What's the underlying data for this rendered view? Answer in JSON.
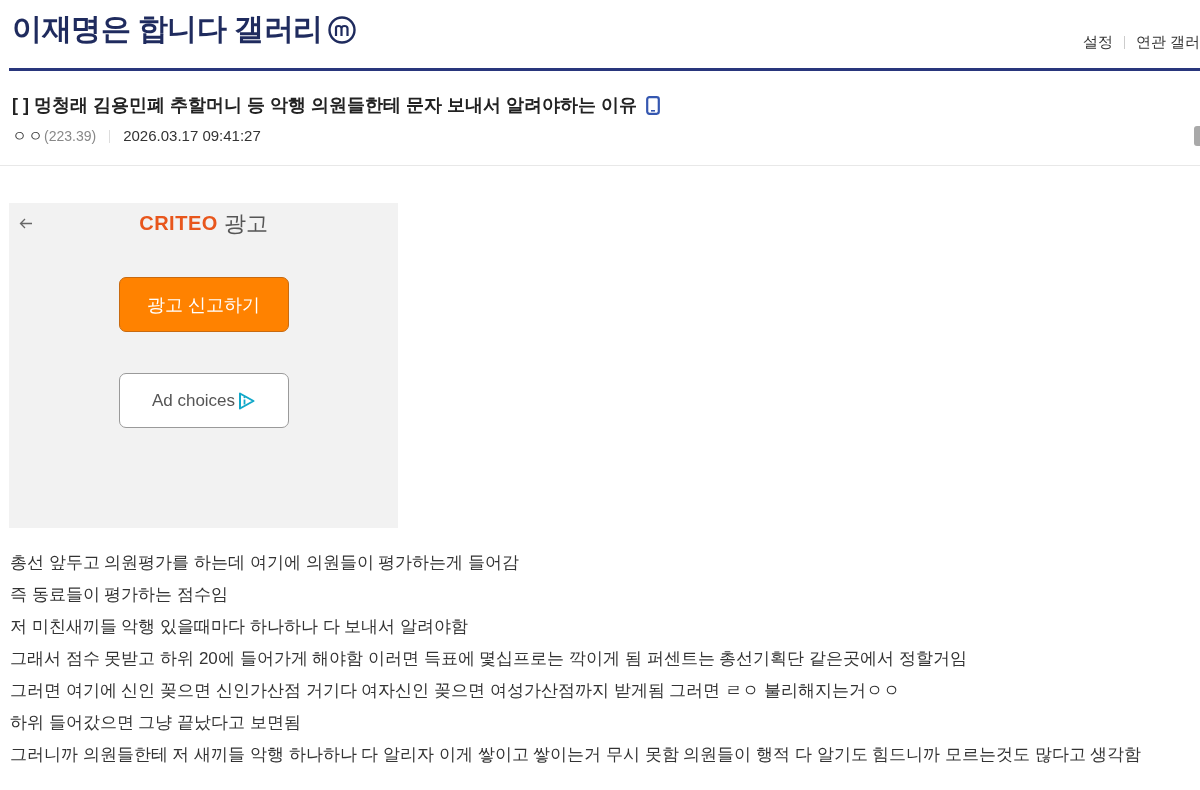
{
  "gallery": {
    "title": "이재명은 합니다 갤러리"
  },
  "top_links": [
    "설정",
    "연관 갤러"
  ],
  "post": {
    "title": "[ ] 멍청래 김용민폐 추할머니 등 악행 의원들한테 문자 보내서 알려야하는 이유",
    "author": "ㅇㅇ",
    "ip": "(223.39)",
    "date": "2026.03.17 09:41:27"
  },
  "ad": {
    "brand": "CRITEO",
    "label": "광고",
    "buttons": [
      {
        "label": "광고 신고하기",
        "kind": "report"
      },
      {
        "label": "Ad choices",
        "kind": "choices"
      }
    ]
  },
  "body": [
    "총선 앞두고 의원평가를 하는데 여기에 의원들이 평가하는게 들어감",
    "즉 동료들이 평가하는 점수임",
    "저 미친새끼들 악행 있을때마다 하나하나 다 보내서 알려야함",
    "그래서 점수 못받고 하위 20에 들어가게 해야함 이러면 득표에 몇십프로는 깍이게 됨 퍼센트는 총선기획단 같은곳에서 정할거임",
    "그러면 여기에 신인 꽂으면 신인가산점 거기다 여자신인 꽂으면 여성가산점까지 받게됨 그러면 ㄹㅇ 불리해지는거ㅇㅇ",
    "하위 들어갔으면 그냥 끝났다고 보면됨",
    "그러니까 의원들한테 저 새끼들 악행 하나하나 다 알리자 이게 쌓이고 쌓이는거 무시 못함 의원들이 행적 다 알기도 힘드니까 모르는것도 많다고 생각함"
  ]
}
